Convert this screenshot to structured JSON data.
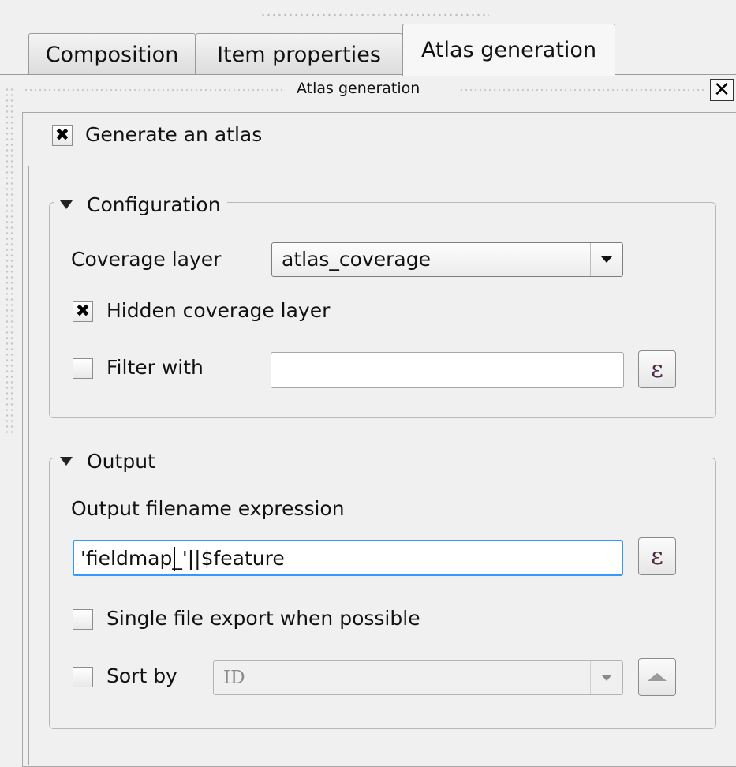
{
  "tabs": [
    {
      "label": "Composition",
      "active": false
    },
    {
      "label": "Item properties",
      "active": false
    },
    {
      "label": "Atlas generation",
      "active": true
    }
  ],
  "dock": {
    "title": "Atlas generation",
    "close_glyph": "✕"
  },
  "atlas": {
    "generate_label": "Generate an atlas",
    "generate_checked": true
  },
  "configuration": {
    "title": "Configuration",
    "coverage_layer_label": "Coverage layer",
    "coverage_layer_value": "atlas_coverage",
    "hidden_coverage_label": "Hidden coverage layer",
    "hidden_coverage_checked": true,
    "filter_with_label": "Filter with",
    "filter_with_checked": false,
    "filter_value": ""
  },
  "output": {
    "title": "Output",
    "filename_label": "Output filename expression",
    "filename_value": "'fieldmap_'||$feature",
    "single_file_label": "Single file export when possible",
    "single_file_checked": false,
    "sort_by_label": "Sort by",
    "sort_by_checked": false,
    "sort_by_value": "ID"
  },
  "icons": {
    "check": "✖",
    "expression": "ε",
    "collapse": "triangle-down-icon",
    "dropdown": "chevron-down-icon",
    "sort_order": "triangle-up-icon"
  },
  "colors": {
    "focus_border": "#3399ff",
    "panel_bg": "#f0f0f0",
    "expression_icon": "#4a2a45"
  }
}
